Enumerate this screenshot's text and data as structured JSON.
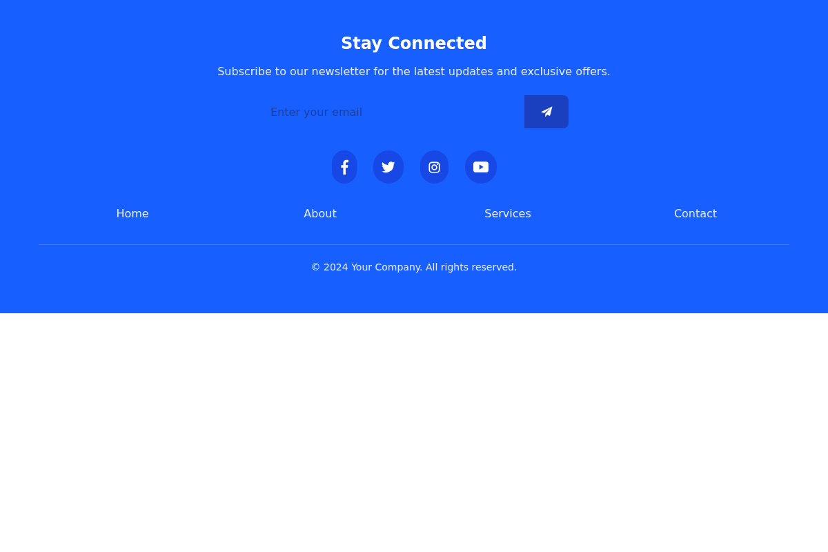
{
  "newsletter": {
    "title": "Stay Connected",
    "subtitle": "Subscribe to our newsletter for the latest updates and exclusive offers.",
    "email": {
      "placeholder": "Enter your email"
    }
  },
  "social": [
    {
      "kind": "facebook"
    },
    {
      "kind": "twitter"
    },
    {
      "kind": "instagram"
    },
    {
      "kind": "youtube"
    }
  ],
  "nav": [
    "Home",
    "About",
    "Services",
    "Contact"
  ],
  "copyright": "© 2024 Your Company. All rights reserved."
}
